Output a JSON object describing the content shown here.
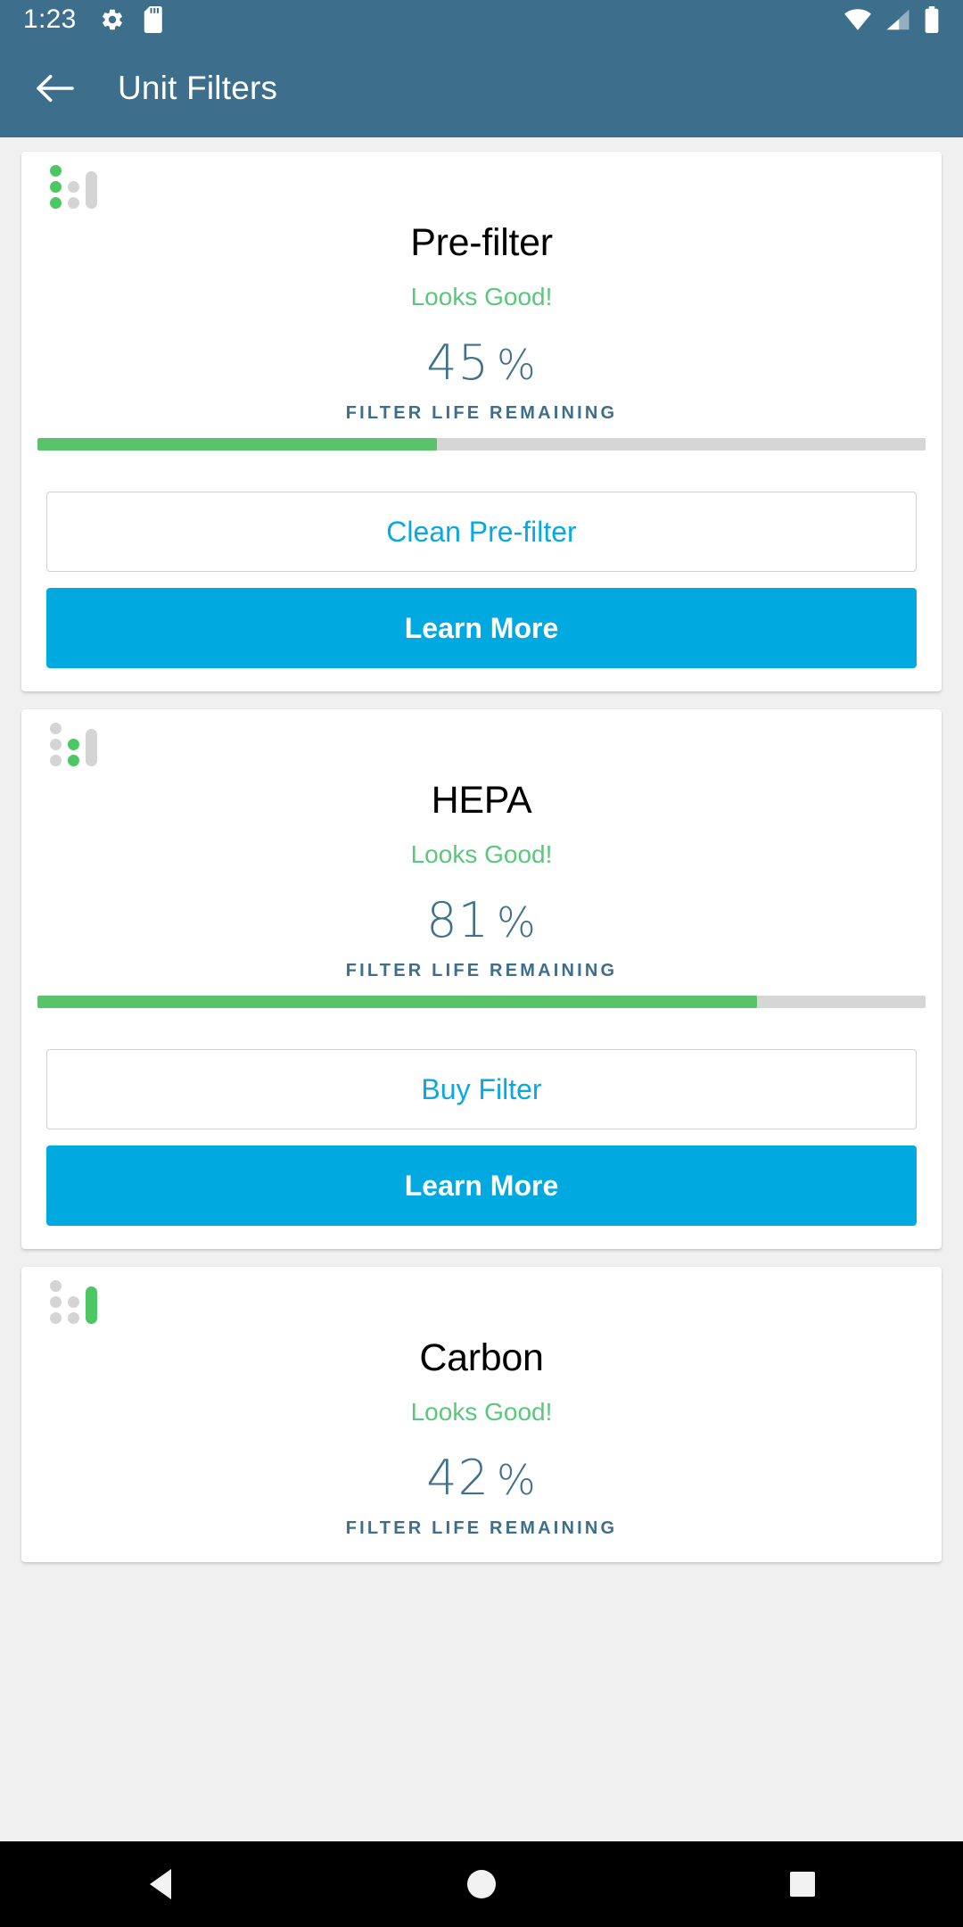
{
  "status_bar": {
    "time": "1:23",
    "icons": [
      "gear-icon",
      "sd-card-icon",
      "wifi-icon",
      "cellular-signal-icon",
      "battery-icon"
    ]
  },
  "app_bar": {
    "back_label": "back-arrow-icon",
    "title": "Unit Filters"
  },
  "colors": {
    "app_bar_bg": "#3d6e8c",
    "page_bg": "#f0f0f0",
    "card_bg": "#ffffff",
    "status_good": "#5ac87c",
    "percent_text": "#41708c",
    "bar_fill": "#5ac26a",
    "bar_track": "#d6d6d6",
    "primary_button": "#00a9e0",
    "outline_button_text": "#0aa8e0",
    "icon_green": "#4cc764",
    "icon_gray": "#d4d4d4"
  },
  "filters": [
    {
      "icon": "filter-level-icon",
      "icon_pattern": {
        "dots": [
          "on",
          "on",
          "on"
        ],
        "mid": [
          "off",
          "off"
        ],
        "right": "off"
      },
      "name": "Pre-filter",
      "status": "Looks Good!",
      "percent_value": "45",
      "percent_unit": "%",
      "percent_number": 45,
      "sub_label": "FILTER LIFE REMAINING",
      "secondary_button": "Clean Pre-filter",
      "primary_button": "Learn More"
    },
    {
      "icon": "filter-level-icon",
      "icon_pattern": {
        "dots": [
          "off",
          "off",
          "off"
        ],
        "mid": [
          "on",
          "on"
        ],
        "right": "off"
      },
      "name": "HEPA",
      "status": "Looks Good!",
      "percent_value": "81",
      "percent_unit": "%",
      "percent_number": 81,
      "sub_label": "FILTER LIFE REMAINING",
      "secondary_button": "Buy Filter",
      "primary_button": "Learn More"
    },
    {
      "icon": "filter-level-icon",
      "icon_pattern": {
        "dots": [
          "off",
          "off",
          "off"
        ],
        "mid": [
          "off",
          "off"
        ],
        "right": "on"
      },
      "name": "Carbon",
      "status": "Looks Good!",
      "percent_value": "42",
      "percent_unit": "%",
      "percent_number": 42,
      "sub_label": "FILTER LIFE REMAINING",
      "secondary_button": "",
      "primary_button": ""
    }
  ],
  "nav_bar": {
    "back": "nav-back-icon",
    "home": "nav-home-icon",
    "recents": "nav-recents-icon"
  }
}
